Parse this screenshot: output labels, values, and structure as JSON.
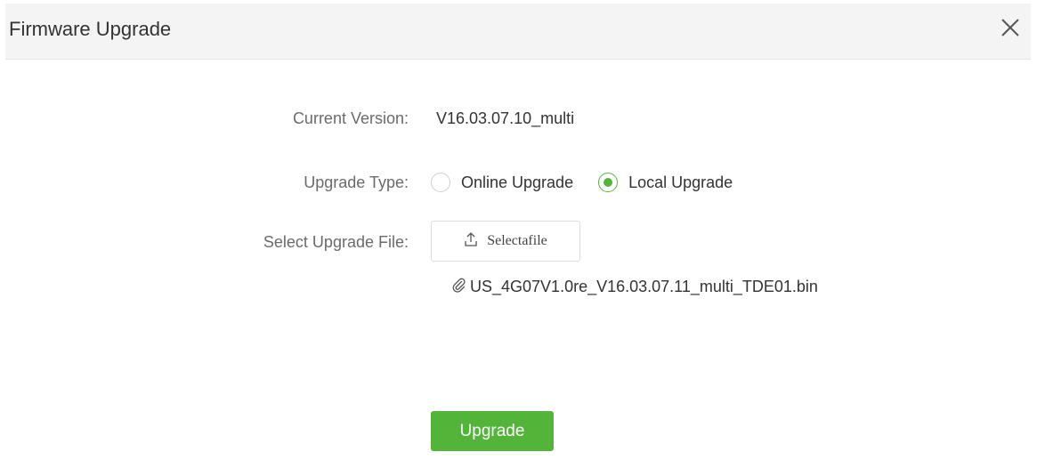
{
  "dialog": {
    "title": "Firmware Upgrade"
  },
  "form": {
    "current_version_label": "Current Version:",
    "current_version_value": "V16.03.07.10_multi",
    "upgrade_type_label": "Upgrade Type:",
    "upgrade_type_options": [
      {
        "label": "Online Upgrade",
        "selected": false
      },
      {
        "label": "Local Upgrade",
        "selected": true
      }
    ],
    "select_file_label": "Select Upgrade File:",
    "select_file_button": "Selectafile",
    "selected_file_name": "US_4G07V1.0re_V16.03.07.11_multi_TDE01.bin"
  },
  "actions": {
    "upgrade_button": "Upgrade"
  },
  "colors": {
    "accent": "#52b53a",
    "header_bg": "#f4f4f4"
  },
  "icons": {
    "close": "close-icon",
    "upload": "upload-icon",
    "attachment": "paperclip-icon"
  }
}
